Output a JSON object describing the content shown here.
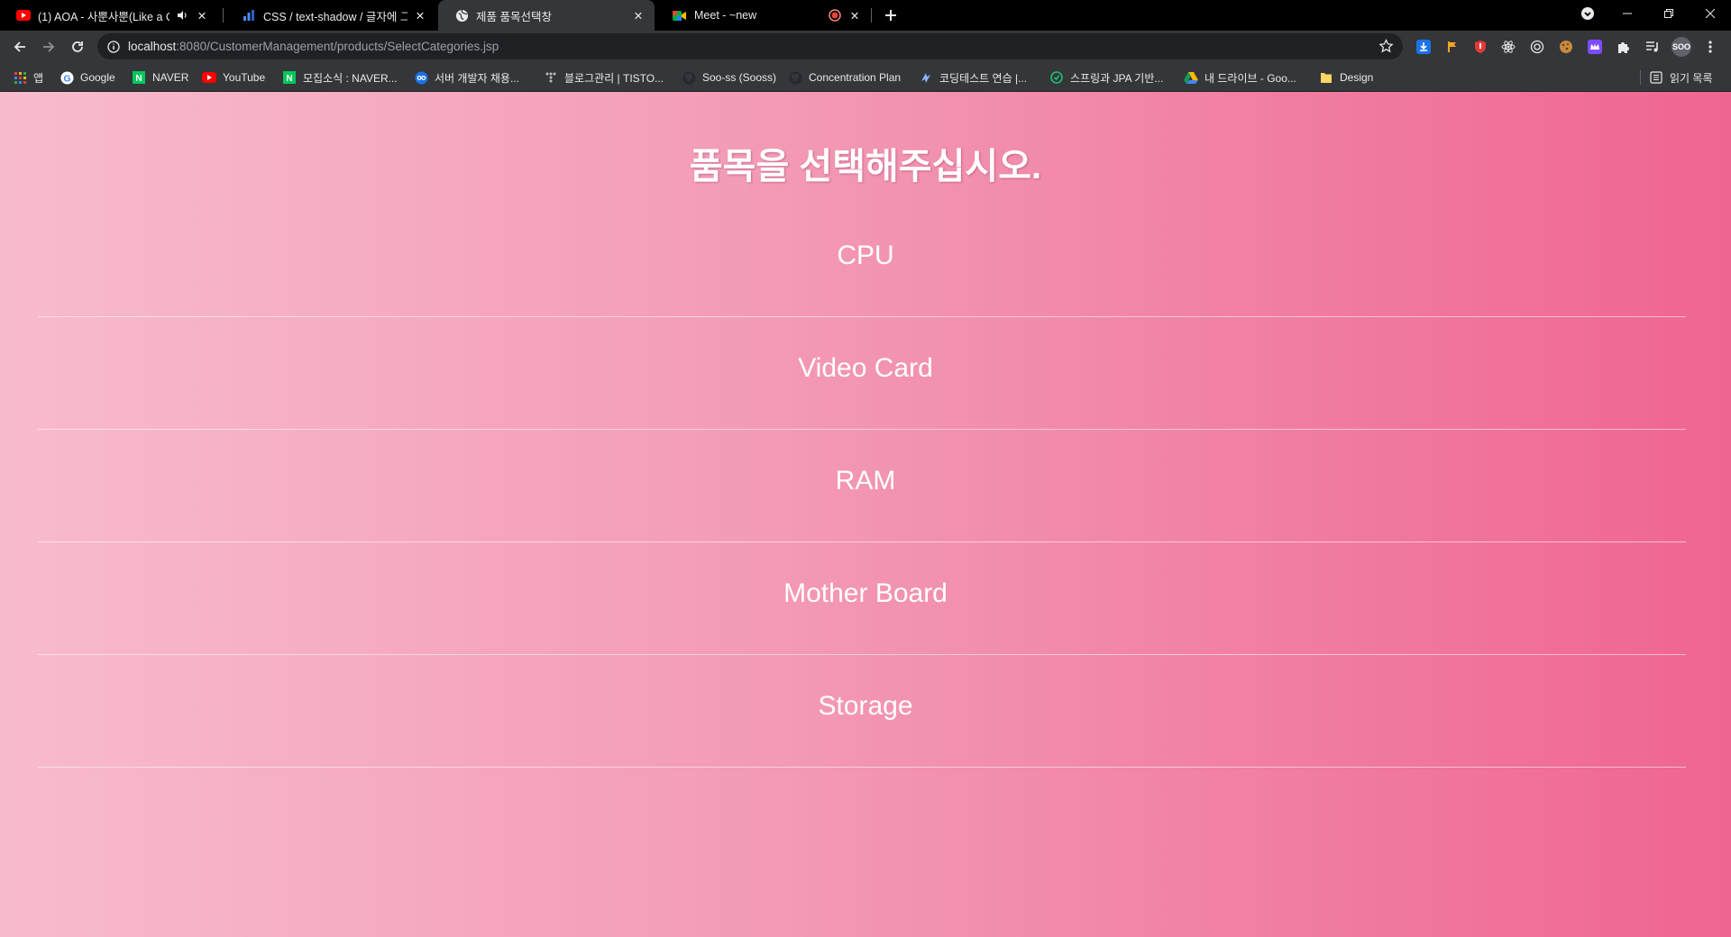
{
  "tabs": [
    {
      "title": "(1) AOA - 사뿐사뿐(Like a C",
      "icon": "youtube-icon"
    },
    {
      "title": "CSS / text-shadow / 글자에 그림",
      "icon": "blog-icon"
    },
    {
      "title": "제품 품목선택창",
      "icon": "globe-icon"
    },
    {
      "title": "Meet - ~new",
      "icon": "meet-icon"
    }
  ],
  "address": {
    "host": "localhost",
    "path": ":8080/CustomerManagement/products/SelectCategories.jsp"
  },
  "profile": {
    "label": "SOO"
  },
  "bookmarks": [
    {
      "label": "앱",
      "icon": "apps-grid-icon"
    },
    {
      "label": "Google",
      "icon": "google-icon"
    },
    {
      "label": "NAVER",
      "icon": "naver-icon"
    },
    {
      "label": "YouTube",
      "icon": "youtube-icon"
    },
    {
      "label": "모집소식 : NAVER...",
      "icon": "naver-icon"
    },
    {
      "label": "서버 개발자 채용...",
      "icon": "loop-icon"
    },
    {
      "label": "블로그관리 | TISTO...",
      "icon": "tistory-icon"
    },
    {
      "label": "Soo-ss (Sooss)",
      "icon": "github-icon"
    },
    {
      "label": "Concentration Plan",
      "icon": "github-icon"
    },
    {
      "label": "코딩테스트 연습 |...",
      "icon": "programmers-icon"
    },
    {
      "label": "스프링과 JPA 기반...",
      "icon": "inflearn-icon"
    },
    {
      "label": "내 드라이브 - Goo...",
      "icon": "google-drive-icon"
    },
    {
      "label": "Design",
      "icon": "folder-icon"
    }
  ],
  "reading_list": {
    "label": "읽기 목록"
  },
  "page": {
    "title": "품목을 선택해주십시오.",
    "categories": [
      "CPU",
      "Video Card",
      "RAM",
      "Mother Board",
      "Storage"
    ]
  },
  "colors": {
    "gradient_start": "#f8bbcd",
    "gradient_end": "#ef6591"
  }
}
